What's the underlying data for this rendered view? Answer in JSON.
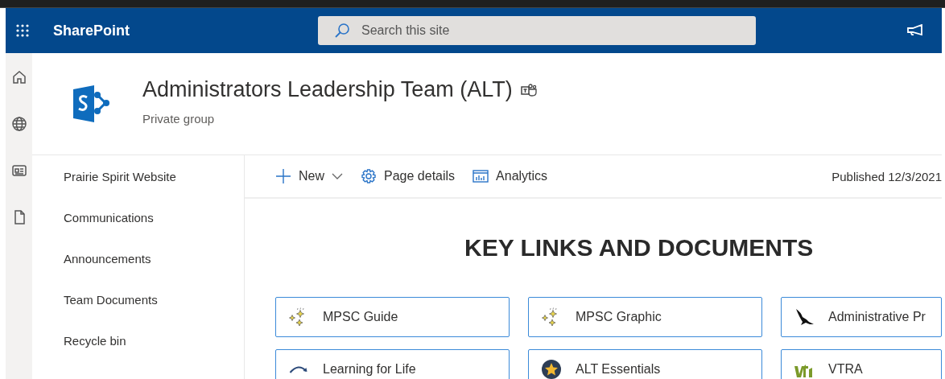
{
  "app_bar": {
    "app_name": "SharePoint",
    "search": {
      "placeholder": "Search this site"
    }
  },
  "site_header": {
    "title": "Administrators Leadership Team (ALT)",
    "subtitle": "Private group"
  },
  "rail": {
    "items": [
      {
        "kind": "home"
      },
      {
        "kind": "globe"
      },
      {
        "kind": "news"
      },
      {
        "kind": "file"
      }
    ]
  },
  "nav": {
    "items": [
      {
        "label": "Prairie Spirit Website"
      },
      {
        "label": "Communications"
      },
      {
        "label": "Announcements"
      },
      {
        "label": "Team Documents"
      },
      {
        "label": "Recycle bin"
      }
    ]
  },
  "command_bar": {
    "items": [
      {
        "kind": "new",
        "label": "New"
      },
      {
        "kind": "details",
        "label": "Page details"
      },
      {
        "kind": "analytics",
        "label": "Analytics"
      }
    ],
    "status": "Published 12/3/2021"
  },
  "section": {
    "heading": "KEY LINKS AND DOCUMENTS",
    "links": [
      {
        "kind": "sparkles",
        "label": "MPSC Guide"
      },
      {
        "kind": "sparkles",
        "label": "MPSC Graphic"
      },
      {
        "kind": "bird",
        "label": "Administrative Pr"
      },
      {
        "kind": "arrow",
        "label": "Learning for Life"
      },
      {
        "kind": "star",
        "label": "ALT Essentials"
      },
      {
        "kind": "logo",
        "label": "VTRA"
      }
    ]
  }
}
